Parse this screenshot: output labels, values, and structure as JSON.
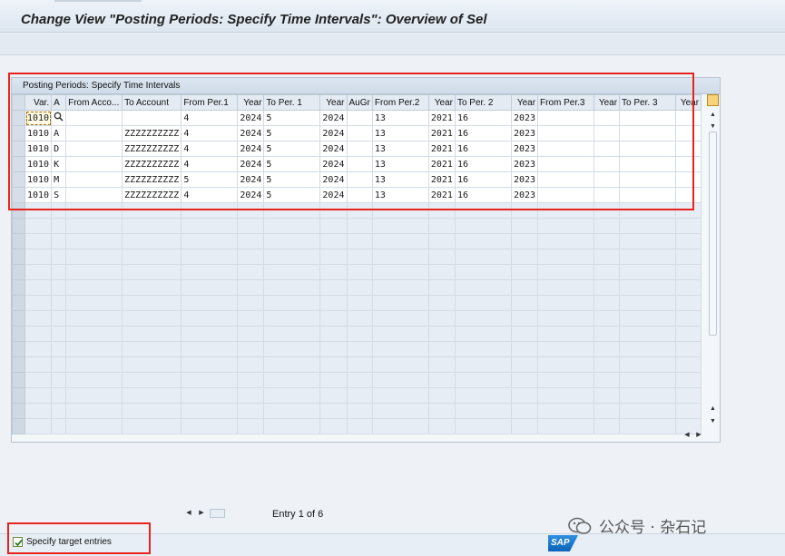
{
  "window": {
    "title": "Change View \"Posting Periods: Specify Time Intervals\": Overview of Sel"
  },
  "panel": {
    "caption": "Posting Periods: Specify Time Intervals"
  },
  "table": {
    "columns": [
      "Var.",
      "A",
      "From Acco...",
      "To Account",
      "From Per.1",
      "Year",
      "To Per. 1",
      "Year",
      "AuGr",
      "From Per.2",
      "Year",
      "To Per. 2",
      "Year",
      "From Per.3",
      "Year",
      "To Per. 3",
      "Year"
    ],
    "rows": [
      [
        "1010",
        "",
        "",
        "",
        "4",
        "2024",
        "5",
        "2024",
        "",
        "13",
        "2021",
        "16",
        "2023",
        "",
        "",
        "",
        ""
      ],
      [
        "1010",
        "A",
        "",
        "ZZZZZZZZZZ",
        "4",
        "2024",
        "5",
        "2024",
        "",
        "13",
        "2021",
        "16",
        "2023",
        "",
        "",
        "",
        ""
      ],
      [
        "1010",
        "D",
        "",
        "ZZZZZZZZZZ",
        "4",
        "2024",
        "5",
        "2024",
        "",
        "13",
        "2021",
        "16",
        "2023",
        "",
        "",
        "",
        ""
      ],
      [
        "1010",
        "K",
        "",
        "ZZZZZZZZZZ",
        "4",
        "2024",
        "5",
        "2024",
        "",
        "13",
        "2021",
        "16",
        "2023",
        "",
        "",
        "",
        ""
      ],
      [
        "1010",
        "M",
        "",
        "ZZZZZZZZZZ",
        "5",
        "2024",
        "5",
        "2024",
        "",
        "13",
        "2021",
        "16",
        "2023",
        "",
        "",
        "",
        ""
      ],
      [
        "1010",
        "S",
        "",
        "ZZZZZZZZZZ",
        "4",
        "2024",
        "5",
        "2024",
        "",
        "13",
        "2021",
        "16",
        "2023",
        "",
        "",
        "",
        ""
      ]
    ],
    "empty_row_count": 15
  },
  "footer": {
    "entry_text": "Entry 1 of 6",
    "checkbox_label": "Specify target entries",
    "checkbox_checked": true
  },
  "brand": {
    "logo_text": "SAP",
    "watermark_text": "公众号 · 杂石记"
  },
  "colors": {
    "highlight": "#e8231e",
    "sap_blue": "#0a63b8",
    "window_bg": "#eef2f7"
  },
  "icons": [
    "search-icon",
    "table-settings-icon",
    "scroll-up-icon",
    "scroll-down-icon",
    "scroll-left-icon",
    "scroll-right-icon",
    "checkbox-icon",
    "wechat-icon"
  ]
}
